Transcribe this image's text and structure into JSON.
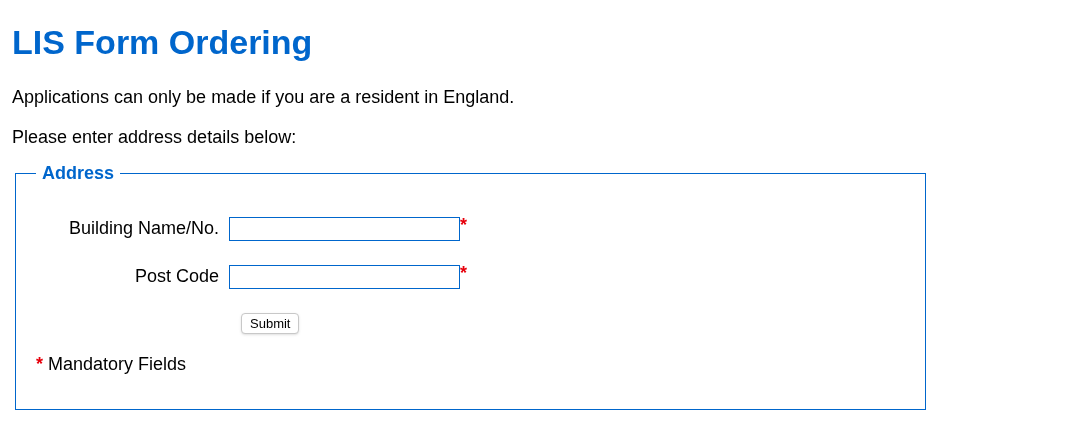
{
  "title": "LIS Form Ordering",
  "intro": [
    "Applications can only be made if you are a resident in England.",
    "Please enter address details below:"
  ],
  "fieldset": {
    "legend": "Address",
    "fields": [
      {
        "label": "Building Name/No.",
        "required_mark": "*"
      },
      {
        "label": "Post Code",
        "required_mark": "*"
      }
    ],
    "submit": "Submit",
    "note": {
      "mark": "*",
      "text": "Mandatory Fields"
    }
  }
}
